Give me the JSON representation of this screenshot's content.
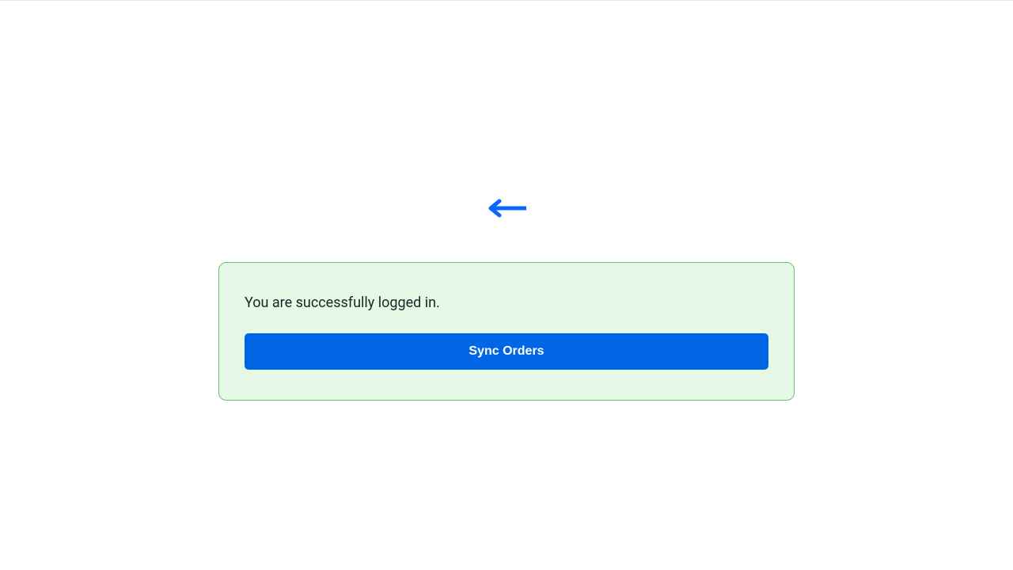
{
  "card": {
    "status_text": "You are successfully logged in.",
    "sync_button_label": "Sync Orders"
  },
  "colors": {
    "button_bg": "#0066e6",
    "card_bg": "#e6f9e6",
    "card_border": "#6cc070",
    "arrow": "#0a66ff"
  }
}
